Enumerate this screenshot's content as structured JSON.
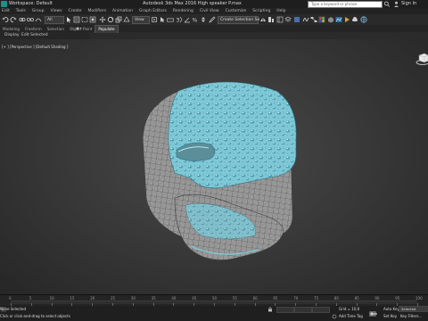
{
  "app": {
    "workspace": "Workspace: Default",
    "title": "Autodesk 3ds Max 2016    High speaker P.max",
    "search_placeholder": "Type a keyword or phrase",
    "sign_in": "Sign In"
  },
  "menu": [
    "Edit",
    "Tools",
    "Group",
    "Views",
    "Create",
    "Modifiers",
    "Animation",
    "Graph Editors",
    "Rendering",
    "Civil View",
    "Customize",
    "Scripting",
    "Help"
  ],
  "toolbar": {
    "selection_filter": "All",
    "view_dropdown": "View",
    "selection_set": "Create Selection Se"
  },
  "ribbon": {
    "tabs": [
      "Modeling",
      "Freeform",
      "Selection",
      "Object Paint",
      "Populate"
    ],
    "active_tab": "Populate"
  },
  "subtoolbar": {
    "display": "Display",
    "edit_selected": "Edit Selected"
  },
  "viewport": {
    "label": "[+ ] [Perspective ] [Default Shading ]"
  },
  "timeline": {
    "ticks": [
      "0",
      "5",
      "10",
      "15",
      "20",
      "25",
      "30",
      "35",
      "40",
      "45",
      "50",
      "55",
      "60",
      "65",
      "70",
      "75",
      "80",
      "85",
      "90",
      "95",
      "100"
    ]
  },
  "status": {
    "selection": "None Selected",
    "prompt": "Click or click-and-drag to select objects",
    "grid": "Grid = 10,0",
    "add_time_tag": "Add Time Tag",
    "auto_key": "Auto Key",
    "selected_label": "Selected",
    "set_key": "Set Key",
    "key_filters": "Key Filters..."
  },
  "colors": {
    "tile_blue": "#7fc8d6",
    "accent_blue": "#2f7fc0"
  }
}
